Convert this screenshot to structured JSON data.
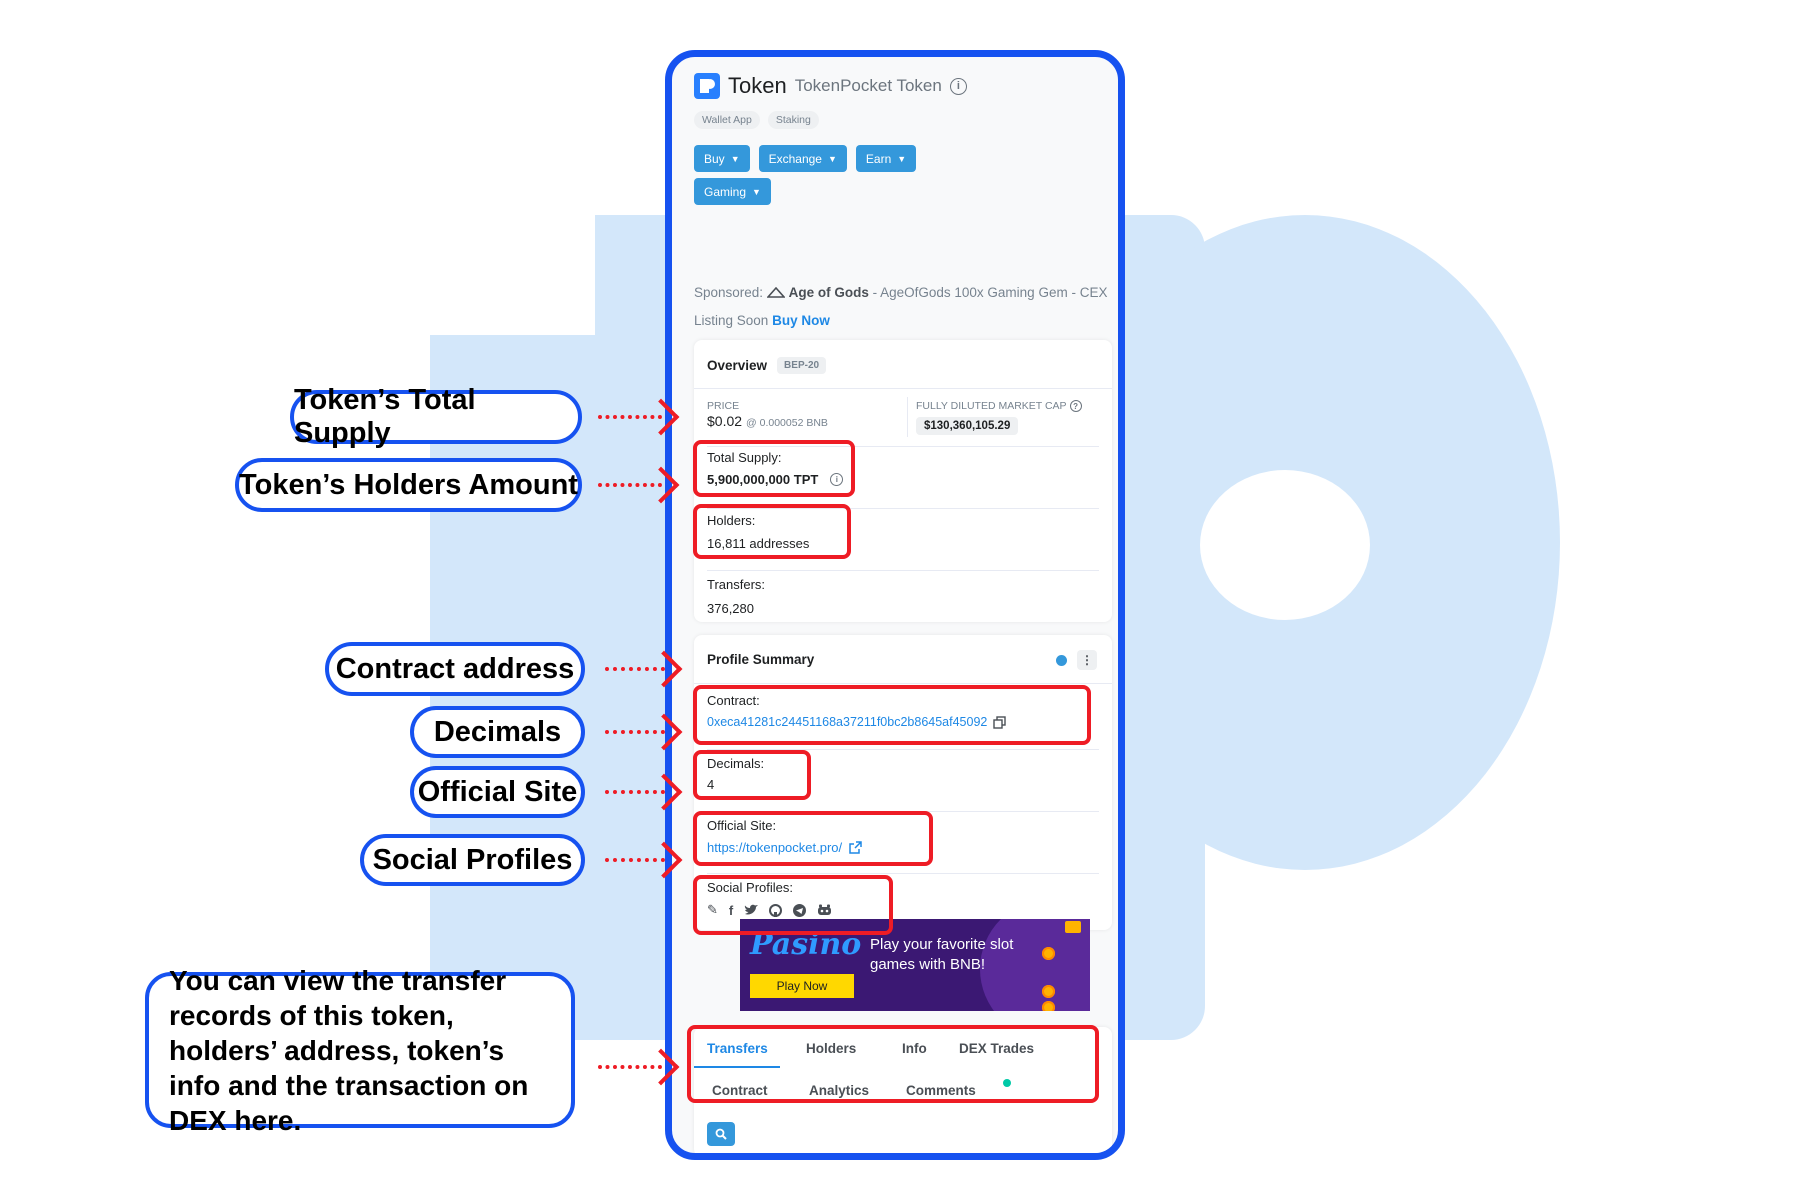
{
  "header": {
    "title": "Token",
    "subtitle": "TokenPocket Token",
    "chips": [
      "Wallet App",
      "Staking"
    ],
    "buttons": [
      "Buy",
      "Exchange",
      "Earn",
      "Gaming"
    ]
  },
  "sponsored": {
    "prefix": "Sponsored:",
    "brand": "Age of Gods",
    "text": "- AgeOfGods 100x Gaming Gem - CEX Listing Soon",
    "cta": "Buy Now"
  },
  "overview": {
    "title": "Overview",
    "badge": "BEP-20",
    "price_label": "PRICE",
    "price_value": "$0.02",
    "price_bnb": "@ 0.000052 BNB",
    "mcap_label": "FULLY DILUTED MARKET CAP",
    "mcap_value": "$130,360,105.29",
    "total_supply_label": "Total Supply:",
    "total_supply_value": "5,900,000,000 TPT",
    "holders_label": "Holders:",
    "holders_value": "16,811 addresses",
    "transfers_label": "Transfers:",
    "transfers_value": "376,280"
  },
  "profile": {
    "title": "Profile Summary",
    "contract_label": "Contract:",
    "contract_value": "0xeca41281c24451168a37211f0bc2b8645af45092",
    "decimals_label": "Decimals:",
    "decimals_value": "4",
    "site_label": "Official Site:",
    "site_value": "https://tokenpocket.pro/",
    "social_label": "Social Profiles:",
    "social_icons": [
      "pencil-icon",
      "facebook-icon",
      "twitter-icon",
      "github-icon",
      "telegram-icon",
      "discord-icon"
    ]
  },
  "ad": {
    "logo": "Pasino",
    "text": "Play your favorite slot games with BNB!",
    "button": "Play Now"
  },
  "tabs": [
    "Transfers",
    "Holders",
    "Info",
    "DEX Trades",
    "Contract",
    "Analytics",
    "Comments"
  ],
  "callouts": {
    "total_supply": "Token’s Total Supply",
    "holders": "Token’s Holders Amount",
    "contract": "Contract address",
    "decimals": "Decimals",
    "site": "Official Site",
    "social": "Social Profiles",
    "tabs": "You can view the transfer records of this token, holders’ address, token’s info and the transaction on DEX here."
  },
  "colors": {
    "frame_blue": "#1652f0",
    "highlight_red": "#ee1c25",
    "link_blue": "#1e88e5",
    "button_blue": "#3498db",
    "background_logo": "#d3e7fa"
  }
}
